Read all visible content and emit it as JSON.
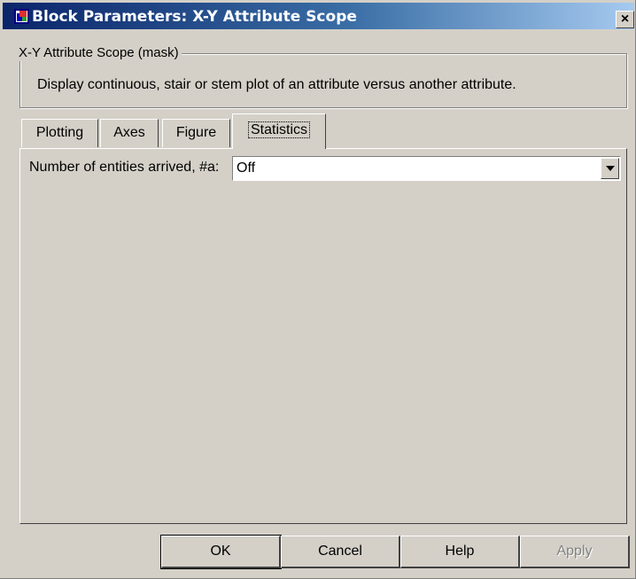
{
  "window": {
    "title": "Block Parameters: X-Y Attribute Scope",
    "close_glyph": "×",
    "icon": "simulink-block-icon"
  },
  "mask": {
    "group_label": "X-Y Attribute Scope (mask)",
    "description": "Display continuous, stair or stem plot of an attribute versus another attribute."
  },
  "tabs": [
    {
      "label": "Plotting"
    },
    {
      "label": "Axes"
    },
    {
      "label": "Figure"
    },
    {
      "label": "Statistics",
      "active": true
    }
  ],
  "statistics": {
    "field_label": "Number of entities arrived, #a:",
    "field_value": "Off"
  },
  "buttons": {
    "ok": "OK",
    "cancel": "Cancel",
    "help": "Help",
    "apply": "Apply"
  }
}
